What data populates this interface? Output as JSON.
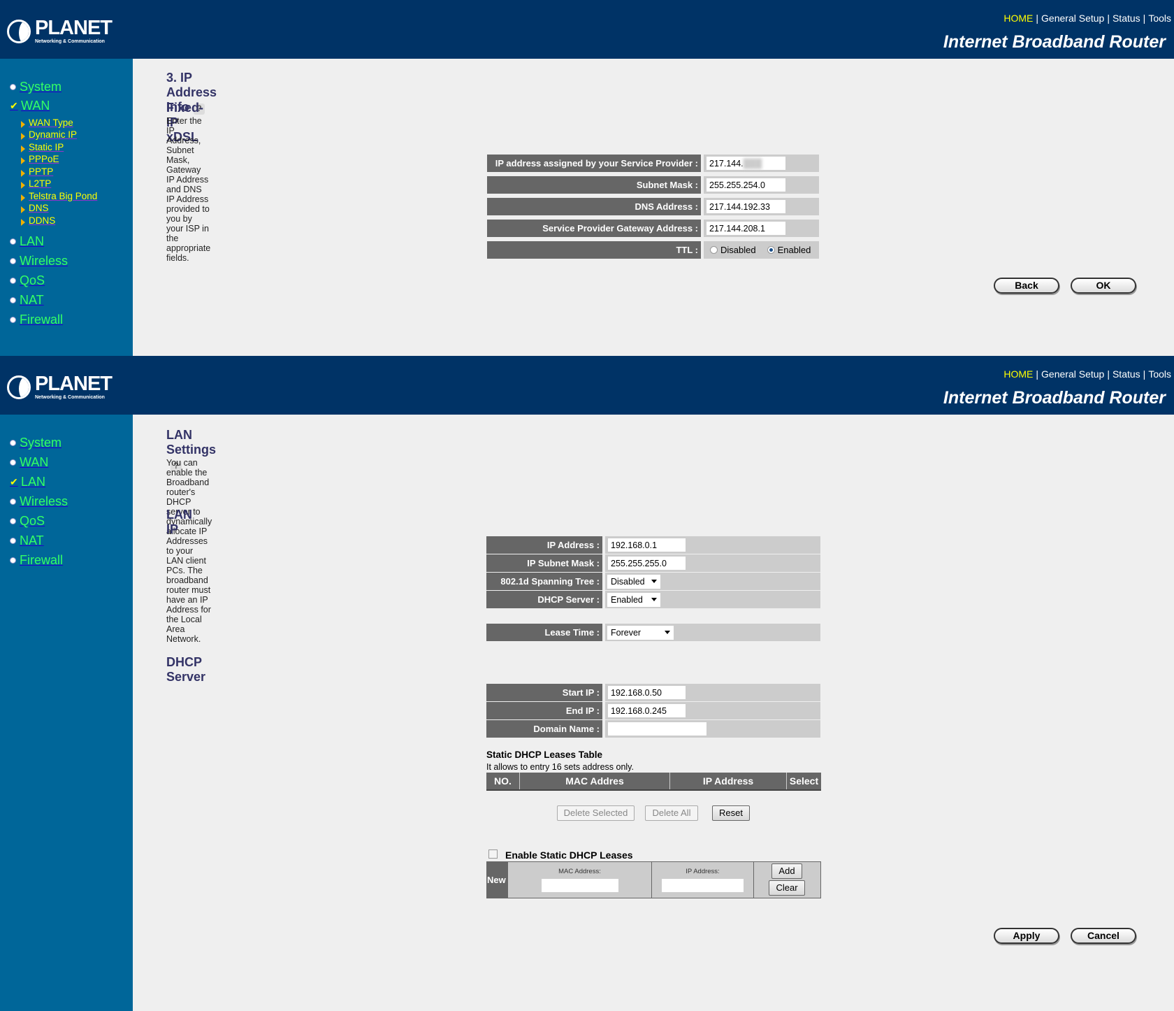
{
  "header": {
    "brand": "PLANET",
    "tagline": "Networking & Communication",
    "nav": [
      "HOME",
      "General Setup",
      "Status",
      "Tools"
    ],
    "title": "Internet Broadband Router"
  },
  "panel1": {
    "sidebar": {
      "system": "System",
      "wan": "WAN",
      "wan_sub": [
        "WAN Type",
        "Dynamic IP",
        "Static IP",
        "PPPoE",
        "PPTP",
        "L2TP",
        "Telstra Big Pond",
        "DNS",
        "DDNS"
      ],
      "lan": "LAN",
      "wireless": "Wireless",
      "qos": "QoS",
      "nat": "NAT",
      "firewall": "Firewall"
    },
    "title": "3. IP Address Info",
    "subtitle": "Fixed-IP xDSL",
    "description": "Enter the IP Address, Subnet Mask, Gateway IP Address and DNS IP Address provided to you by your ISP in the appropriate fields.",
    "fields": [
      {
        "label": "IP address assigned by your Service Provider :",
        "value": "217.144."
      },
      {
        "label": "Subnet Mask :",
        "value": "255.255.254.0"
      },
      {
        "label": "DNS Address :",
        "value": "217.144.192.33"
      },
      {
        "label": "Service Provider Gateway Address :",
        "value": "217.144.208.1"
      }
    ],
    "ttl": {
      "label": "TTL :",
      "options": [
        "Disabled",
        "Enabled"
      ],
      "selected": "Enabled"
    },
    "back": "Back",
    "ok": "OK"
  },
  "panel2": {
    "sidebar": {
      "system": "System",
      "wan": "WAN",
      "lan": "LAN",
      "wireless": "Wireless",
      "qos": "QoS",
      "nat": "NAT",
      "firewall": "Firewall"
    },
    "title": "LAN Settings",
    "description": "You can enable the Broadband router's DHCP server to dynamically allocate IP Addresses to your LAN client PCs. The broadband router must have an IP Address for the Local Area Network.",
    "lan_ip_heading": "LAN IP",
    "ip_address": {
      "label": "IP Address :",
      "value": "192.168.0.1"
    },
    "subnet": {
      "label": "IP Subnet Mask :",
      "value": "255.255.255.0"
    },
    "spanning": {
      "label": "802.1d Spanning Tree :",
      "value": "Disabled"
    },
    "dhcp_server": {
      "label": "DHCP Server :",
      "value": "Enabled"
    },
    "lease": {
      "label": "Lease Time :",
      "value": "Forever"
    },
    "dhcp_heading": "DHCP Server",
    "start_ip": {
      "label": "Start IP :",
      "value": "192.168.0.50"
    },
    "end_ip": {
      "label": "End IP :",
      "value": "192.168.0.245"
    },
    "domain": {
      "label": "Domain Name :",
      "value": ""
    },
    "static_table": {
      "title": "Static DHCP Leases Table",
      "note": "It allows to entry 16 sets address only.",
      "columns": [
        "NO.",
        "MAC Addres",
        "IP Address",
        "Select"
      ]
    },
    "delete_selected": "Delete Selected",
    "delete_all": "Delete All",
    "reset": "Reset",
    "enable_static": {
      "label": "Enable Static DHCP Leases",
      "checked": false
    },
    "new_entry": {
      "label": "New",
      "mac_label": "MAC Address:",
      "ip_label": "IP Address:",
      "mac_value": "",
      "ip_value": "",
      "add": "Add",
      "clear": "Clear"
    },
    "apply": "Apply",
    "cancel": "Cancel"
  }
}
